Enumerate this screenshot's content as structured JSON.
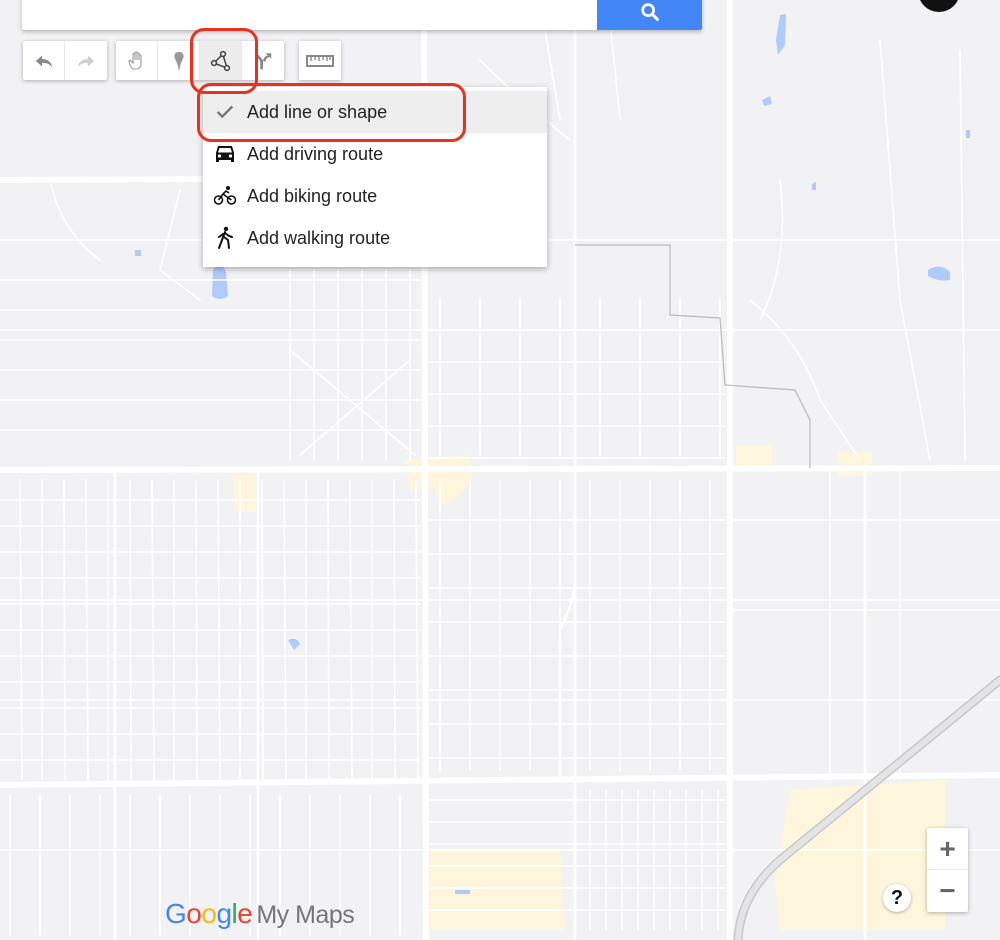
{
  "search": {
    "value": "",
    "placeholder": "",
    "button_icon": "search-icon"
  },
  "toolbar": {
    "undo": {
      "icon": "undo-icon",
      "label": "Undo"
    },
    "redo": {
      "icon": "redo-icon",
      "label": "Redo"
    },
    "pan": {
      "icon": "hand-icon",
      "label": "Select items"
    },
    "marker": {
      "icon": "marker-icon",
      "label": "Add marker"
    },
    "draw_line": {
      "icon": "draw-line-icon",
      "label": "Draw a line",
      "active": true
    },
    "directions": {
      "icon": "directions-icon",
      "label": "Add directions"
    },
    "measure": {
      "icon": "ruler-icon",
      "label": "Measure distances and areas"
    }
  },
  "draw_menu": {
    "items": [
      {
        "label": "Add line or shape",
        "icon": "checkmark-icon",
        "selected": true
      },
      {
        "label": "Add driving route",
        "icon": "car-icon",
        "selected": false
      },
      {
        "label": "Add biking route",
        "icon": "bike-icon",
        "selected": false
      },
      {
        "label": "Add walking route",
        "icon": "walk-icon",
        "selected": false
      }
    ]
  },
  "logo": {
    "google": [
      "G",
      "o",
      "o",
      "g",
      "l",
      "e"
    ],
    "product": "My Maps"
  },
  "map_controls": {
    "zoom_in": "+",
    "zoom_out": "−",
    "help": "?"
  },
  "colors": {
    "accent": "#4285f4",
    "annotation": "#e8321f",
    "map_background": "#f2f2f4",
    "water": "#aecbfa",
    "poi_area": "#fdf6dc"
  }
}
